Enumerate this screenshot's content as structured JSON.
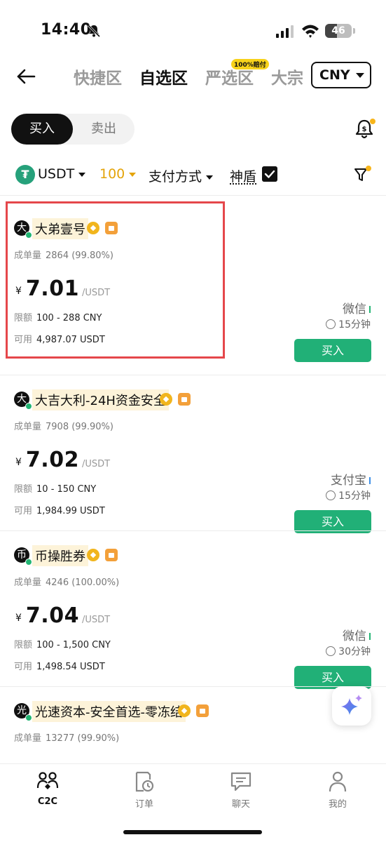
{
  "status_bar": {
    "time": "14:40",
    "battery": "46"
  },
  "header": {
    "tabs": [
      {
        "label": "快捷区",
        "active": false
      },
      {
        "label": "自选区",
        "active": true
      },
      {
        "label": "严选区",
        "active": false,
        "badge": "100%赔付"
      },
      {
        "label": "大宗",
        "active": false
      }
    ],
    "currency": "CNY"
  },
  "toggle": {
    "buy": "买入",
    "sell": "卖出"
  },
  "filters": {
    "asset": "USDT",
    "amount": "100",
    "payment": "支付方式",
    "shield": "神盾"
  },
  "listings": [
    {
      "avatar": "大",
      "name": "大弟壹号",
      "deal_label": "成单量",
      "deal_value": "2864 (99.80%)",
      "currency_symbol": "¥",
      "price": "7.01",
      "unit": "/USDT",
      "limit_label": "限额",
      "limit_value": "100 - 288 CNY",
      "avail_label": "可用",
      "avail_value": "4,987.07 USDT",
      "pay_method": "微信",
      "pay_color": "#22b573",
      "time": "15分钟",
      "buy_label": "买入"
    },
    {
      "avatar": "大",
      "name": "大吉大利-24H资金安全",
      "deal_label": "成单量",
      "deal_value": "7908 (99.90%)",
      "currency_symbol": "¥",
      "price": "7.02",
      "unit": "/USDT",
      "limit_label": "限额",
      "limit_value": "10 - 150 CNY",
      "avail_label": "可用",
      "avail_value": "1,984.99 USDT",
      "pay_method": "支付宝",
      "pay_color": "#3b8ee6",
      "time": "15分钟",
      "buy_label": "买入"
    },
    {
      "avatar": "币",
      "name": "币操胜券",
      "deal_label": "成单量",
      "deal_value": "4246 (100.00%)",
      "currency_symbol": "¥",
      "price": "7.04",
      "unit": "/USDT",
      "limit_label": "限额",
      "limit_value": "100 - 1,500 CNY",
      "avail_label": "可用",
      "avail_value": "1,498.54 USDT",
      "pay_method": "微信",
      "pay_color": "#22b573",
      "time": "30分钟",
      "buy_label": "买入"
    },
    {
      "avatar": "光",
      "name": "光速资本-安全首选-零冻结",
      "deal_label": "成单量",
      "deal_value": "13277 (99.90%)"
    }
  ],
  "bottom_nav": [
    {
      "label": "C2C",
      "icon": "people-icon",
      "active": true
    },
    {
      "label": "订单",
      "icon": "orders-icon",
      "active": false
    },
    {
      "label": "聊天",
      "icon": "chat-icon",
      "active": false
    },
    {
      "label": "我的",
      "icon": "profile-icon",
      "active": false
    }
  ]
}
